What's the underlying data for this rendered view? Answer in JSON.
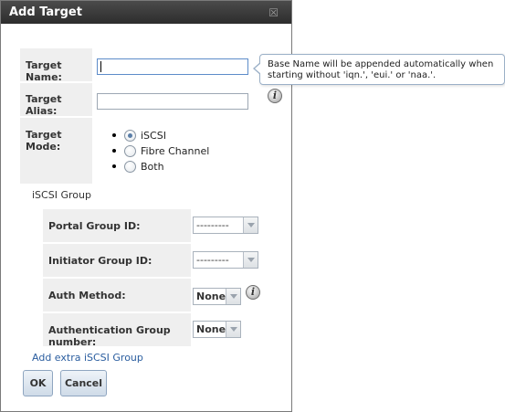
{
  "dialog": {
    "title": "Add Target",
    "close_glyph": "☒"
  },
  "fields": {
    "target_name": {
      "label": "Target Name:",
      "value": ""
    },
    "target_alias": {
      "label": "Target Alias:",
      "value": ""
    },
    "target_mode": {
      "label": "Target Mode:",
      "options": [
        "iSCSI",
        "Fibre Channel",
        "Both"
      ],
      "selected": "iSCSI"
    }
  },
  "tooltip": {
    "text": "Base Name will be appended automatically when starting without 'iqn.', 'eui.' or 'naa.'."
  },
  "iscsi_group": {
    "title": "iSCSI Group",
    "portal_group_id": {
      "label": "Portal Group ID:",
      "value": "---------"
    },
    "initiator_group_id": {
      "label": "Initiator Group ID:",
      "value": "---------"
    },
    "auth_method": {
      "label": "Auth Method:",
      "value": "None"
    },
    "auth_group_number": {
      "label": "Authentication Group number:",
      "value": "None"
    }
  },
  "add_extra_link": "Add extra iSCSI Group",
  "buttons": {
    "ok": "OK",
    "cancel": "Cancel"
  },
  "icons": {
    "info": "i"
  },
  "colors": {
    "titlebar": "#3a3a3a",
    "label_bg": "#efefef",
    "link": "#2a5d9f",
    "button_border": "#8fa6c0"
  }
}
